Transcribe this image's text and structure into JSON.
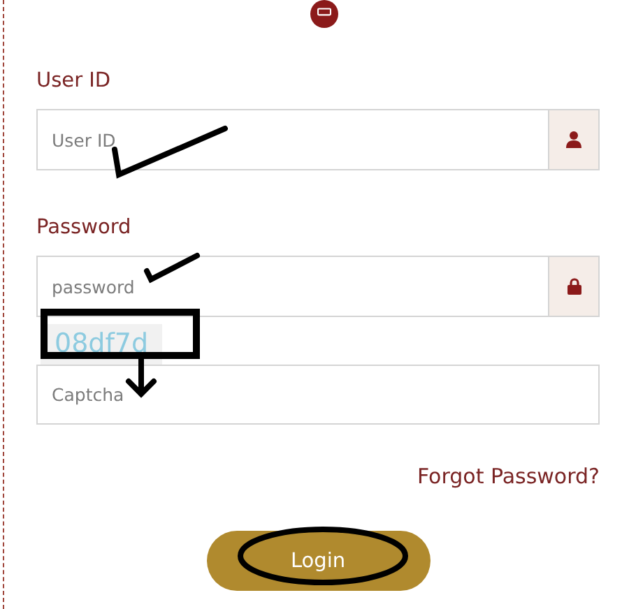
{
  "fields": [
    {
      "label": "User ID",
      "placeholder": "User ID",
      "kind": "user"
    },
    {
      "label": "Password",
      "placeholder": "password",
      "kind": "lock"
    }
  ],
  "captcha": {
    "code": "08df7d",
    "placeholder": "Captcha"
  },
  "forgot_link": "Forgot Password?",
  "login_button": "Login"
}
